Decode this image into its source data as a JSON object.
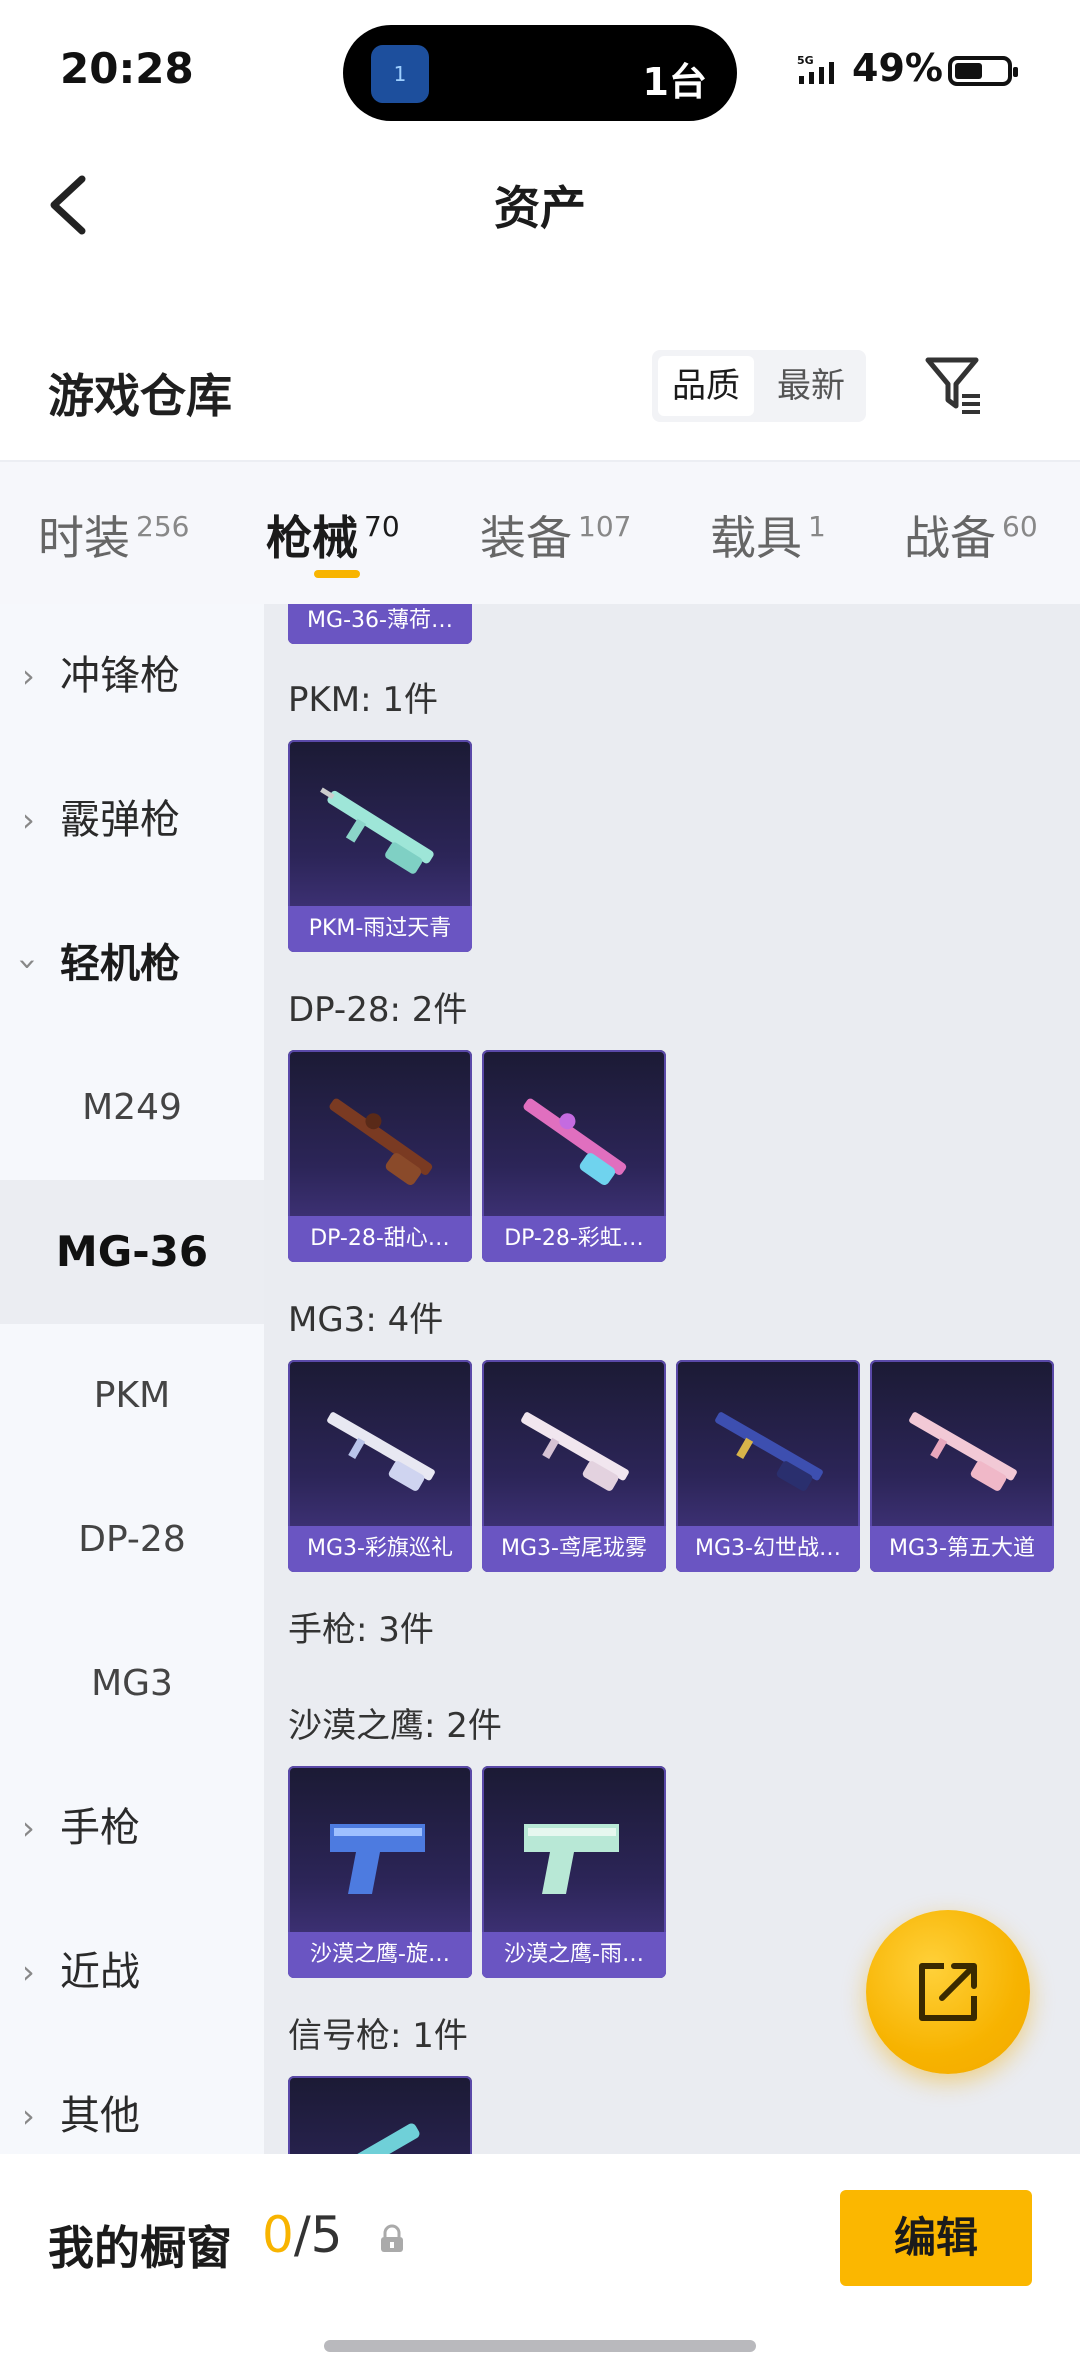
{
  "status_bar": {
    "time": "20:28",
    "island_icon_text": "1",
    "island_text": "1台",
    "network": "5G",
    "battery": "49%"
  },
  "titlebar": {
    "title": "资产"
  },
  "header": {
    "title": "游戏仓库",
    "sort_options": [
      "品质",
      "最新"
    ],
    "selected_sort": "品质"
  },
  "tabs": [
    {
      "label": "时装",
      "count": "256"
    },
    {
      "label": "枪械",
      "count": "70"
    },
    {
      "label": "装备",
      "count": "107"
    },
    {
      "label": "载具",
      "count": "1"
    },
    {
      "label": "战备",
      "count": "60"
    }
  ],
  "active_tab": "枪械",
  "leftnav": {
    "cat_smg": "冲锋枪",
    "cat_shotgun": "霰弹枪",
    "cat_lmg": "轻机枪",
    "sub_m249": "M249",
    "sub_mg36": "MG-36",
    "sub_pkm": "PKM",
    "sub_dp28": "DP-28",
    "sub_mg3": "MG3",
    "cat_pistol": "手枪",
    "cat_melee": "近战",
    "cat_other": "其他",
    "selected": "MG-36"
  },
  "content": {
    "top_partial_card": "MG-36-薄荷…",
    "sections": {
      "pkm": {
        "title": "PKM: 1件",
        "items": [
          "PKM-雨过天青"
        ]
      },
      "dp28": {
        "title": "DP-28: 2件",
        "items": [
          "DP-28-甜心…",
          "DP-28-彩虹…"
        ]
      },
      "mg3": {
        "title": "MG3: 4件",
        "items": [
          "MG3-彩旗巡礼",
          "MG3-鸢尾珑雾",
          "MG3-幻世战…",
          "MG3-第五大道"
        ]
      },
      "pistol": {
        "title": "手枪: 3件"
      },
      "deagle": {
        "title": "沙漠之鹰: 2件",
        "items": [
          "沙漠之鹰-旋…",
          "沙漠之鹰-雨…"
        ]
      },
      "flare": {
        "title": "信号枪: 1件"
      }
    }
  },
  "bottom": {
    "label": "我的橱窗",
    "count_current": "0",
    "count_total": "/5",
    "edit_label": "编辑"
  },
  "colors": {
    "accent": "#f8b400",
    "card_caption": "#6a55c2",
    "card_bg": "#2c2558"
  },
  "icons": [
    "back-arrow-icon",
    "filter-icon",
    "chevron-right-icon",
    "chevron-down-icon",
    "lock-icon",
    "share-external-icon"
  ]
}
